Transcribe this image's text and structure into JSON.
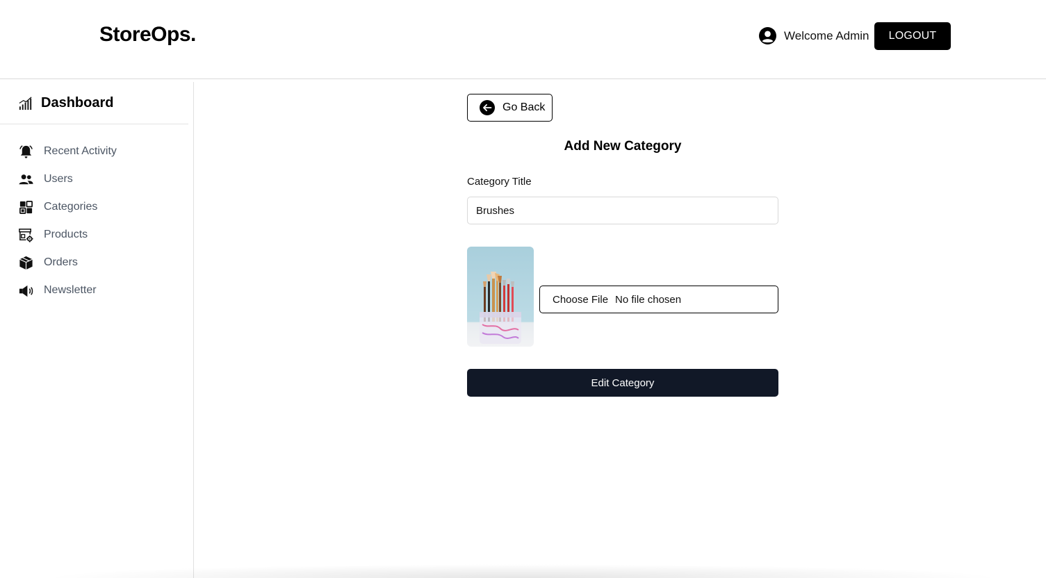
{
  "header": {
    "brand": "StoreOps.",
    "welcome_text": "Welcome Admin",
    "logout_label": "LOGOUT",
    "avatar_icon": "user-circle-icon"
  },
  "sidebar": {
    "title": "Dashboard",
    "title_icon": "signal-bars-icon",
    "items": [
      {
        "label": "Recent Activity",
        "icon": "bell-icon"
      },
      {
        "label": "Users",
        "icon": "users-icon"
      },
      {
        "label": "Categories",
        "icon": "grid-icon"
      },
      {
        "label": "Products",
        "icon": "store-gear-icon"
      },
      {
        "label": "Orders",
        "icon": "box-icon"
      },
      {
        "label": "Newsletter",
        "icon": "megaphone-icon"
      }
    ]
  },
  "form": {
    "back_label": "Go Back",
    "back_icon": "arrow-left-circle-icon",
    "title": "Add New Category",
    "field_label": "Category Title",
    "field_value": "Brushes",
    "file_button": "Choose File",
    "file_status": "No file chosen",
    "submit_label": "Edit Category",
    "thumbnail": "brushes-in-jar-image"
  },
  "colors": {
    "submit_bg": "#111827",
    "logout_bg": "#000000",
    "sidebar_text": "#4b5563"
  }
}
